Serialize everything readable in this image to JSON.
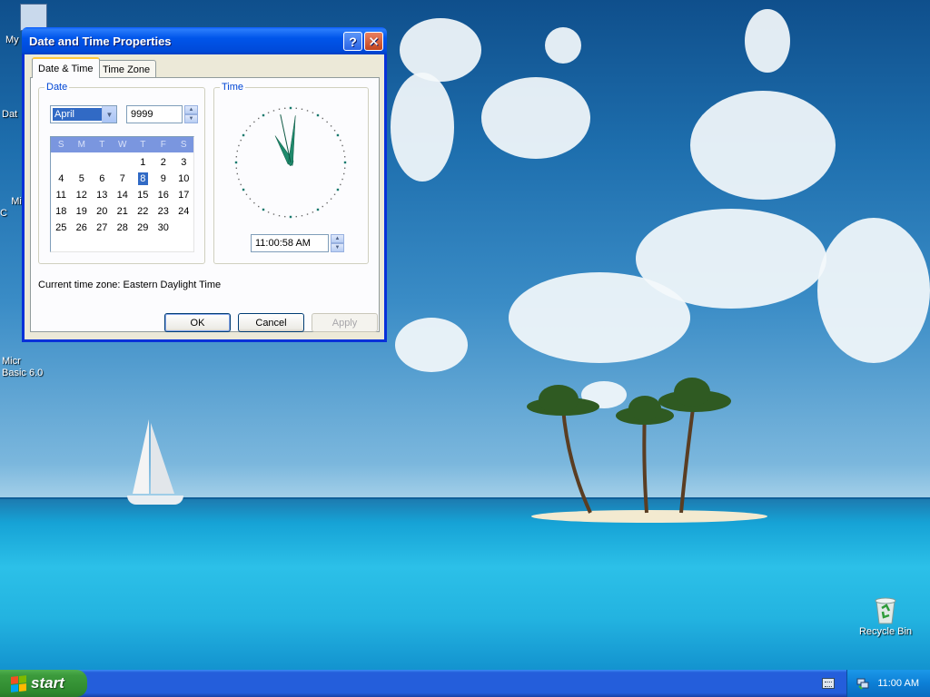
{
  "desktop": {
    "icons": [
      {
        "label": "My",
        "name": "my-computer"
      },
      {
        "label": "Dat",
        "name": "date-shortcut"
      },
      {
        "label": "Micr\nC",
        "name": "microsoft-c"
      },
      {
        "label": "Micr\nBasic 6.0",
        "name": "microsoft-basic"
      },
      {
        "label": "Recycle Bin",
        "name": "recycle-bin"
      }
    ],
    "colors": {
      "sky": "#1e6fae",
      "sea": "#2cc0e8",
      "sand": "#f3ead0"
    }
  },
  "window": {
    "title": "Date and Time Properties",
    "help_label": "?",
    "close_label": "✕",
    "tabs": [
      {
        "label": "Date & Time",
        "active": true
      },
      {
        "label": "Time Zone",
        "active": false
      }
    ],
    "date_group": {
      "label": "Date",
      "month": "April",
      "year": "9999",
      "weekdays": [
        "S",
        "M",
        "T",
        "W",
        "T",
        "F",
        "S"
      ],
      "leading_blanks": 4,
      "days": [
        "1",
        "2",
        "3",
        "4",
        "5",
        "6",
        "7",
        "8",
        "9",
        "10",
        "11",
        "12",
        "13",
        "14",
        "15",
        "16",
        "17",
        "18",
        "19",
        "20",
        "21",
        "22",
        "23",
        "24",
        "25",
        "26",
        "27",
        "28",
        "29",
        "30"
      ],
      "selected_day": "8"
    },
    "time_group": {
      "label": "Time",
      "value": "11:00:58 AM",
      "clock": {
        "hour": 11,
        "minute": 0,
        "second": 58
      }
    },
    "timezone_text": "Current time zone:  Eastern Daylight Time",
    "buttons": {
      "ok": "OK",
      "cancel": "Cancel",
      "apply": "Apply"
    }
  },
  "taskbar": {
    "start_label": "start",
    "clock": "11:00 AM"
  }
}
